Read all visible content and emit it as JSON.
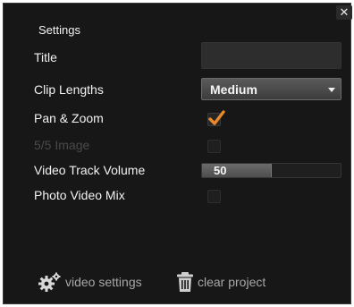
{
  "panel": {
    "title": "Settings",
    "close_glyph": "✕"
  },
  "fields": {
    "title_label": "Title",
    "title_value": "",
    "clip_lengths_label": "Clip Lengths",
    "clip_lengths_value": "Medium",
    "pan_zoom_label": "Pan & Zoom",
    "pan_zoom_checked": true,
    "disabled_label": "5/5 Image",
    "disabled_checked": false,
    "video_volume_label": "Video Track Volume",
    "video_volume_value": "50",
    "video_volume_fraction": 0.5,
    "photo_video_mix_label": "Photo Video Mix",
    "photo_video_mix_checked": false
  },
  "footer": {
    "video_settings_label": "video settings",
    "video_settings_icon": "gear-icon",
    "clear_project_label": "clear project",
    "clear_project_icon": "trash-icon"
  },
  "colors": {
    "panel_bg": "#171717",
    "check_accent": "#e8892c",
    "text": "#f2f2f2",
    "muted_text": "#a8a8a8"
  }
}
